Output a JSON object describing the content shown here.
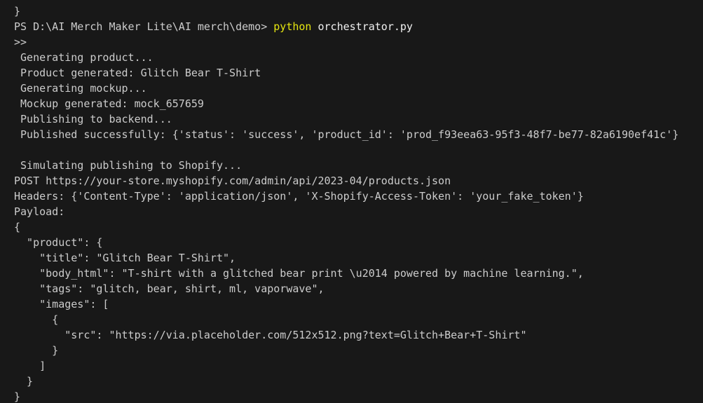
{
  "terminal": {
    "prompt_path": "PS D:\\AI Merch Maker Lite\\AI merch\\demo> ",
    "command_name": "python",
    "command_arg": " orchestrator.py",
    "lines": [
      "}",
      null,
      ">>",
      " Generating product...",
      " Product generated: Glitch Bear T-Shirt",
      " Generating mockup...",
      " Mockup generated: mock_657659",
      " Publishing to backend...",
      " Published successfully: {'status': 'success', 'product_id': 'prod_f93eea63-95f3-48f7-be77-82a6190ef41c'}",
      "",
      " Simulating publishing to Shopify...",
      "POST https://your-store.myshopify.com/admin/api/2023-04/products.json",
      "Headers: {'Content-Type': 'application/json', 'X-Shopify-Access-Token': 'your_fake_token'}",
      "Payload:",
      "{",
      "  \"product\": {",
      "    \"title\": \"Glitch Bear T-Shirt\",",
      "    \"body_html\": \"T-shirt with a glitched bear print \\u2014 powered by machine learning.\",",
      "    \"tags\": \"glitch, bear, shirt, ml, vaporwave\",",
      "    \"images\": [",
      "      {",
      "        \"src\": \"https://via.placeholder.com/512x512.png?text=Glitch+Bear+T-Shirt\"",
      "      }",
      "    ]",
      "  }",
      "}"
    ]
  }
}
